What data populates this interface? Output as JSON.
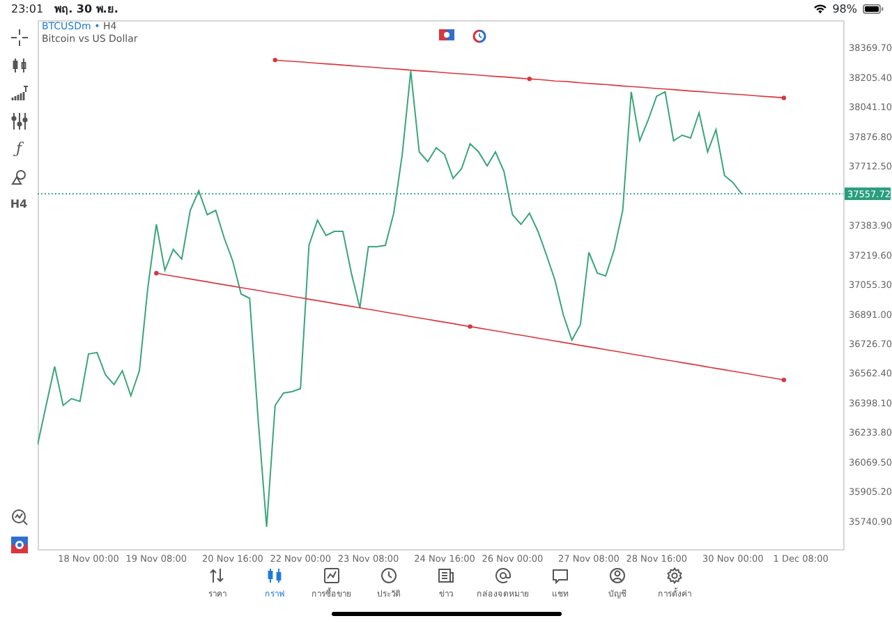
{
  "status_bar": {
    "time": "23:01",
    "date": "พฤ. 30 พ.ย.",
    "battery": "98%"
  },
  "toolbar": {
    "indicator_glyph": "ƒ",
    "timeframe": "H4"
  },
  "chart": {
    "symbol": "BTCUSDm",
    "separator": "•",
    "timeframe": "H4",
    "description": "Bitcoin vs US Dollar",
    "chart_data": {
      "type": "line",
      "categories": [
        null,
        null,
        null,
        null,
        null,
        null,
        "18 Nov 00:00",
        null,
        null,
        null,
        null,
        null,
        null,
        null,
        "19 Nov 08:00",
        null,
        null,
        null,
        null,
        null,
        null,
        null,
        null,
        "20 Nov 16:00",
        null,
        null,
        null,
        null,
        null,
        null,
        null,
        "22 Nov 00:00",
        null,
        null,
        null,
        null,
        null,
        null,
        null,
        "23 Nov 08:00",
        null,
        null,
        null,
        null,
        null,
        null,
        null,
        null,
        "24 Nov 16:00",
        null,
        null,
        null,
        null,
        null,
        null,
        null,
        "26 Nov 00:00",
        null,
        null,
        null,
        null,
        null,
        null,
        null,
        null,
        "27 Nov 08:00",
        null,
        null,
        null,
        null,
        null,
        null,
        null,
        "28 Nov 16:00",
        null,
        null,
        null,
        null,
        null,
        null,
        null,
        null,
        "30 Nov 00:00",
        null,
        null,
        null,
        null,
        null,
        null,
        null,
        "1 Dec 08:00"
      ],
      "series": [
        {
          "color": "#3aa57a",
          "values": [
            36166,
            36383,
            36599,
            36383,
            36421,
            36406,
            36669,
            36677,
            36553,
            36499,
            36576,
            36437,
            36576,
            37040,
            37388,
            37133,
            37249,
            37195,
            37465,
            37574,
            37442,
            37465,
            37311,
            37187,
            37001,
            36978,
            36306,
            35710,
            36383,
            36452,
            36460,
            36476,
            37272,
            37411,
            37326,
            37349,
            37349,
            37117,
            36924,
            37264,
            37264,
            37272,
            37450,
            37775,
            38239,
            37790,
            37736,
            37813,
            37775,
            37643,
            37697,
            37836,
            37790,
            37713,
            37790,
            37682,
            37442,
            37388,
            37450,
            37349,
            37218,
            37079,
            36885,
            36746,
            36831,
            37233,
            37117,
            37102,
            37249,
            37465,
            38123,
            37852,
            37968,
            38099,
            38123,
            37852,
            37883,
            37867,
            38007,
            37790,
            37914,
            37659,
            37620,
            37558,
            null,
            null,
            null,
            null,
            null,
            null,
            null
          ]
        },
        {
          "color": "#d9363e",
          "values": [
            null,
            null,
            null,
            null,
            null,
            null,
            null,
            null,
            null,
            null,
            null,
            null,
            null,
            null,
            null,
            null,
            null,
            null,
            null,
            null,
            null,
            null,
            null,
            null,
            null,
            null,
            null,
            null,
            38300,
            38296,
            38293,
            38290,
            38286,
            38282,
            38279,
            38276,
            38272,
            38268,
            38265,
            38262,
            38258,
            38254,
            38251,
            38248,
            38244,
            38240,
            38237,
            38234,
            38230,
            38226,
            38223,
            38220,
            38216,
            38212,
            38209,
            38206,
            38202,
            38198,
            38195,
            38192,
            38188,
            38184,
            38181,
            38178,
            38174,
            38170,
            38167,
            38164,
            38160,
            38156,
            38153,
            38150,
            38146,
            38142,
            38139,
            38136,
            38132,
            38128,
            38125,
            38122,
            38118,
            38114,
            38111,
            38108,
            38104,
            38100,
            38097,
            38094,
            38090,
            null,
            null
          ]
        },
        {
          "color": "#d9363e",
          "values": [
            null,
            null,
            null,
            null,
            null,
            null,
            null,
            null,
            null,
            null,
            null,
            null,
            null,
            null,
            37117,
            37109,
            37101,
            37093,
            37085,
            37077,
            37069,
            37061,
            37053,
            37045,
            37037,
            37029,
            37021,
            37013,
            37005,
            36997,
            36989,
            36981,
            36973,
            36965,
            36957,
            36949,
            36941,
            36933,
            36925,
            36917,
            36909,
            36901,
            36893,
            36885,
            36877,
            36869,
            36861,
            36853,
            36845,
            36837,
            36829,
            36821,
            36813,
            36805,
            36797,
            36789,
            36781,
            36773,
            36765,
            36757,
            36749,
            36741,
            36733,
            36725,
            36717,
            36709,
            36701,
            36693,
            36685,
            36677,
            36669,
            36661,
            36653,
            36645,
            36637,
            36629,
            36621,
            36613,
            36605,
            36597,
            36589,
            36581,
            36573,
            36565,
            36557,
            36549,
            36541,
            36533,
            36525,
            null,
            null
          ]
        }
      ],
      "ylim": [
        35586,
        38517
      ],
      "yticks": [
        {
          "value": 38369.7,
          "label": "38369.70"
        },
        {
          "value": 38205.4,
          "label": "38205.40"
        },
        {
          "value": 38041.1,
          "label": "38041.10"
        },
        {
          "value": 37876.8,
          "label": "37876.80"
        },
        {
          "value": 37712.5,
          "label": "37712.50"
        },
        {
          "value": 37383.9,
          "label": "37383.90"
        },
        {
          "value": 37219.6,
          "label": "37219.60"
        },
        {
          "value": 37055.3,
          "label": "37055.30"
        },
        {
          "value": 36891,
          "label": "36891.00"
        },
        {
          "value": 36726.7,
          "label": "36726.70"
        },
        {
          "value": 36562.4,
          "label": "36562.40"
        },
        {
          "value": 36398.1,
          "label": "36398.10"
        },
        {
          "value": 36233.8,
          "label": "36233.80"
        },
        {
          "value": 36069.5,
          "label": "36069.50"
        },
        {
          "value": 35905.2,
          "label": "35905.20"
        },
        {
          "value": 35740.9,
          "label": "35740.90"
        }
      ],
      "ref_lines": [
        {
          "axis": "y",
          "value": 37557.72,
          "label": "37557.72"
        }
      ]
    }
  },
  "tabs": [
    {
      "label": "ราคา",
      "selected": false
    },
    {
      "label": "กราฟ",
      "selected": true
    },
    {
      "label": "การซื้อขาย",
      "selected": false
    },
    {
      "label": "ประวัติ",
      "selected": false
    },
    {
      "label": "ข่าว",
      "selected": false
    },
    {
      "label": "กล่องจดหมาย",
      "selected": false
    },
    {
      "label": "แชท",
      "selected": false
    },
    {
      "label": "บัญชี",
      "selected": false
    },
    {
      "label": "การตั้งค่า",
      "selected": false
    }
  ]
}
